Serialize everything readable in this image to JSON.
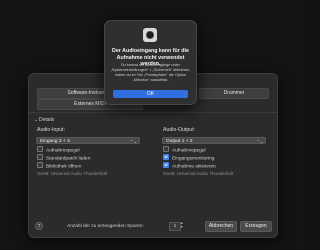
{
  "track_types": {
    "software_instrument": "Software-Instrument",
    "drummer": "Drummer",
    "external_midi": "Externes MIDI"
  },
  "details": {
    "label": "Details"
  },
  "input": {
    "label": "Audio-Input:",
    "value": "Eingang 3 + 4",
    "checkboxes": [
      {
        "label": "Aufnahmepegel",
        "checked": false
      },
      {
        "label": "Standardpatch laden",
        "checked": false
      },
      {
        "label": "Bibliothek öffnen",
        "checked": false
      }
    ],
    "device": "Gerät: Universal Audio Thunderbolt"
  },
  "output": {
    "label": "Audio-Output:",
    "value": "Output 1 + 2",
    "checkboxes": [
      {
        "label": "Aufnahmepegel",
        "checked": false
      },
      {
        "label": "Eingangsmonitoring",
        "checked": true
      },
      {
        "label": "Aufnahme aktivieren",
        "checked": true
      }
    ],
    "device": "Gerät: Universal Audio Thunderbolt"
  },
  "footer": {
    "help": "?",
    "track_count_label": "Anzahl der zu erzeugenden Spuren:",
    "track_count": "1",
    "cancel": "Abbrechen",
    "create": "Erzeugen"
  },
  "alert": {
    "title": "Der Audioeingang kann für die Aufnahme nicht verwendet werden.",
    "body": "Du kannst die Audioeingänge unter „Systemeinstellungen“ > „Sicherheit“ aktivieren, indem du im Tab „Privatsphäre“ die Option „Mikrofon“ auswählst.",
    "ok": "OK"
  },
  "colors": {
    "accent": "#2f6fe0",
    "checkbox_checked": "#3b82f6",
    "sheet_bg": "#2b2b2b",
    "alert_bg": "#2f2f2f"
  }
}
